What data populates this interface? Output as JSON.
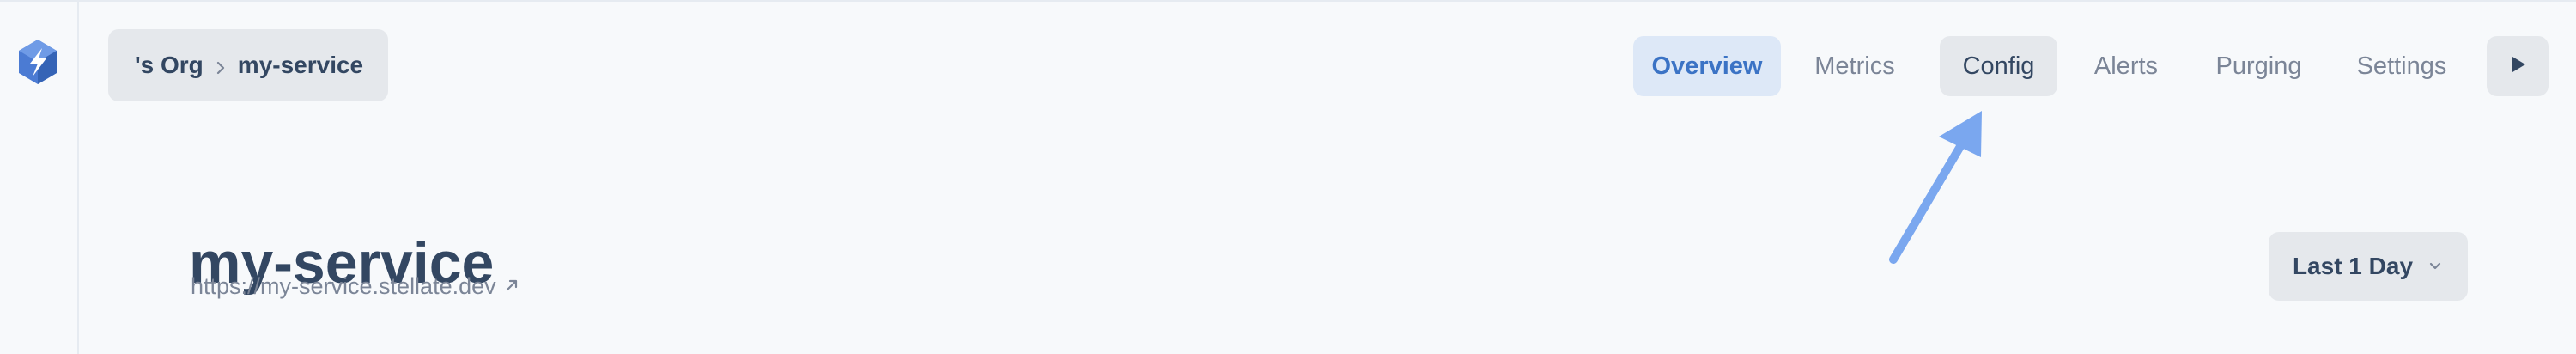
{
  "breadcrumb": {
    "org": "'s Org",
    "project": "my-service"
  },
  "nav": {
    "tabs": [
      {
        "label": "Overview",
        "state": "active"
      },
      {
        "label": "Metrics",
        "state": "default"
      },
      {
        "label": "Config",
        "state": "highlighted"
      },
      {
        "label": "Alerts",
        "state": "default"
      },
      {
        "label": "Purging",
        "state": "default"
      },
      {
        "label": "Settings",
        "state": "default"
      }
    ],
    "play_icon": "play-icon"
  },
  "header": {
    "title": "my-service",
    "url": "https://my-service.stellate.dev",
    "external_link_icon": "external-link-icon"
  },
  "controls": {
    "date_range_label": "Last 1 Day",
    "dropdown_icon": "chevron-down-icon"
  },
  "colors": {
    "primary": "#3b73c5",
    "text": "#334762",
    "muted": "#7b8597",
    "button_bg": "#e5e8ec",
    "active_bg": "#dde8f7",
    "arrow": "#7aa7ef"
  }
}
